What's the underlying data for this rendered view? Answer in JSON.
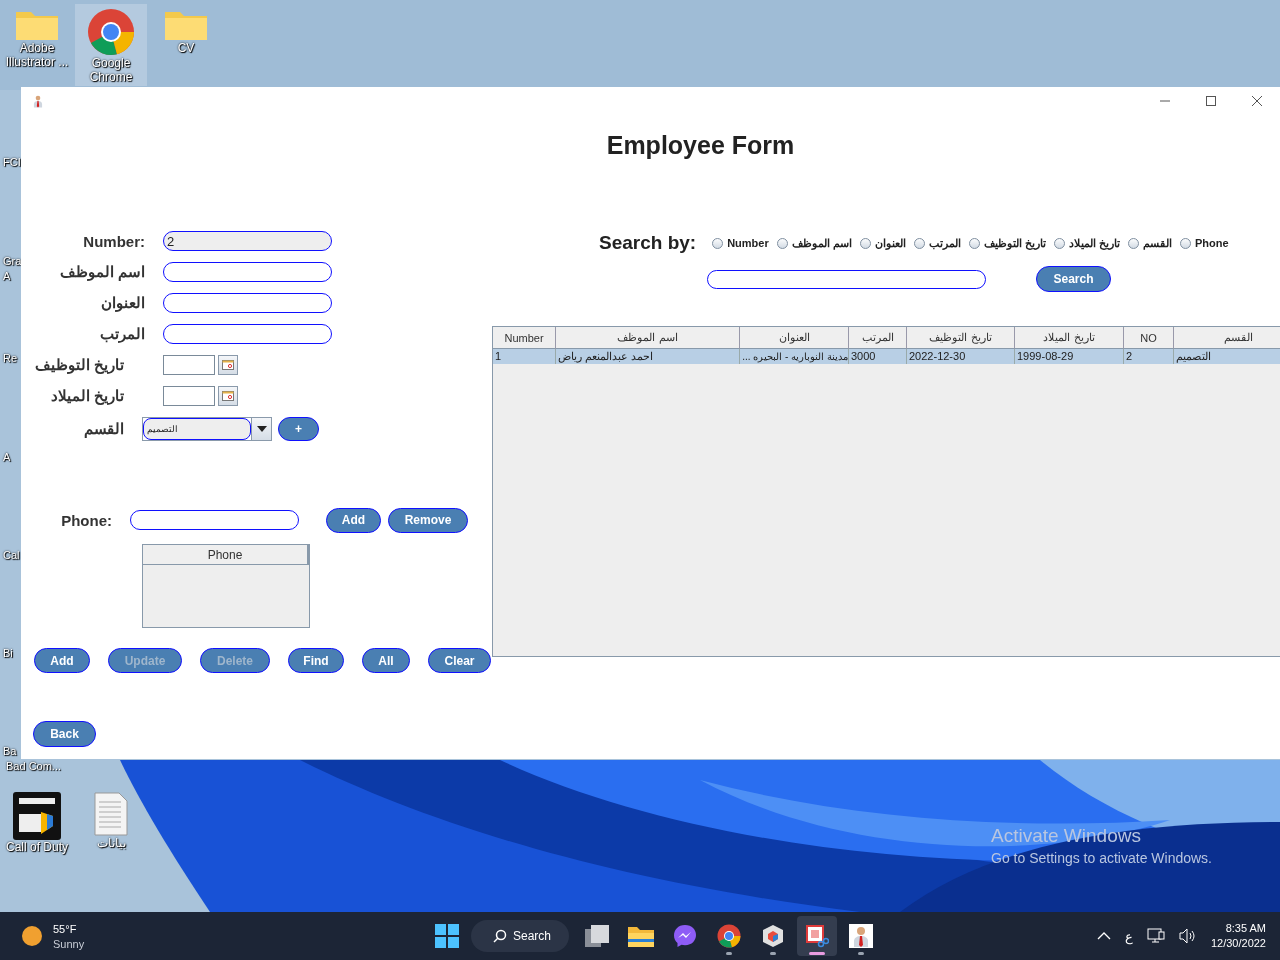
{
  "desktop": {
    "icons": [
      {
        "label": "Adobe Illustrator ...",
        "kind": "folder",
        "selected": false
      },
      {
        "label": "Google Chrome",
        "kind": "chrome",
        "selected": true
      },
      {
        "label": "CV",
        "kind": "folder",
        "selected": false
      },
      {
        "label": "Call of Duty",
        "kind": "game",
        "selected": false
      },
      {
        "label": "بيانات",
        "kind": "document",
        "selected": false
      }
    ],
    "edge_labels": [
      "FCI",
      "Gra",
      "A",
      "Re",
      "A",
      "Cal",
      "Bi",
      "Ba"
    ],
    "below_window_label": "Bad Com...",
    "activation": {
      "title": "Activate Windows",
      "subtitle": "Go to Settings to activate Windows."
    }
  },
  "window": {
    "heading": "Employee Form"
  },
  "form": {
    "fields": [
      {
        "label": "Number:",
        "kind": "text",
        "value": "2",
        "editable": false
      },
      {
        "label": "اسم الموظف",
        "kind": "text",
        "editable": true
      },
      {
        "label": "العنوان",
        "kind": "text",
        "editable": true
      },
      {
        "label": "المرتب",
        "kind": "text",
        "editable": true
      },
      {
        "label": "تاريخ التوظيف",
        "kind": "date",
        "editable": true
      },
      {
        "label": "تاريخ الميلاد",
        "kind": "date",
        "editable": true
      },
      {
        "label": "القسم",
        "kind": "combo",
        "value": "التصميم",
        "editable": false,
        "add_button": "+"
      }
    ]
  },
  "phone": {
    "label": "Phone:",
    "buttons": [
      "Remove",
      "Add"
    ],
    "table": {
      "columns": [
        "Phone"
      ]
    }
  },
  "actions": [
    {
      "label": "Clear",
      "disabled": false
    },
    {
      "label": "All",
      "disabled": false
    },
    {
      "label": "Find",
      "disabled": false
    },
    {
      "label": "Delete",
      "disabled": true
    },
    {
      "label": "Update",
      "disabled": true
    },
    {
      "label": "Add",
      "disabled": false
    }
  ],
  "back_button": "Back",
  "search": {
    "label": "Search by:",
    "options": [
      {
        "label": "Phone",
        "selected": false
      },
      {
        "label": "القسم",
        "selected": false
      },
      {
        "label": "تاريخ الميلاد",
        "selected": false
      },
      {
        "label": "تاريخ التوظيف",
        "selected": false
      },
      {
        "label": "المرتب",
        "selected": false
      },
      {
        "label": "العنوان",
        "selected": false
      },
      {
        "label": "اسم الموظف",
        "selected": false
      },
      {
        "label": "Number",
        "selected": false
      }
    ],
    "button": "Search"
  },
  "table": {
    "columns": [
      "القسم",
      "NO",
      "تاريخ الميلاد",
      "تاريخ التوظيف",
      "المرتب",
      "العنوان",
      "اسم الموظف",
      "Number"
    ],
    "rows": [
      {
        "selected": true,
        "cells": [
          "التصميم",
          "2",
          "1999-08-29",
          "2022-12-30",
          "3000",
          "مدينة النوباريه - البحيره ...",
          "احمد عبدالمنعم رياض",
          "1"
        ]
      }
    ]
  },
  "taskbar": {
    "weather": {
      "temperature": "55°F",
      "condition": "Sunny"
    },
    "search": "Search",
    "apps": [
      {
        "kind": "gallery",
        "running": false,
        "selected": false
      },
      {
        "kind": "folder",
        "running": false,
        "selected": false
      },
      {
        "kind": "chat",
        "running": false,
        "selected": false
      },
      {
        "kind": "chrome",
        "running": true,
        "selected": false
      },
      {
        "kind": "cube",
        "running": true,
        "selected": false
      },
      {
        "kind": "snip",
        "running": true,
        "selected": true
      },
      {
        "kind": "person",
        "running": true,
        "selected": false
      }
    ],
    "language": "ع",
    "time": "8:35 AM",
    "date": "12/30/2022"
  }
}
